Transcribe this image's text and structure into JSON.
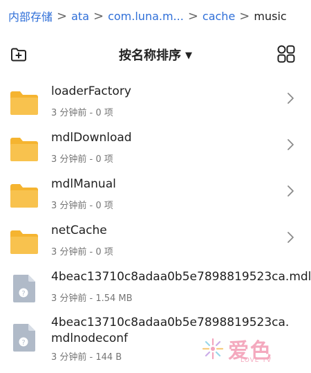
{
  "breadcrumb": {
    "items": [
      "内部存储",
      "ata",
      "com.luna.m...",
      "cache",
      "music"
    ],
    "separator": ">"
  },
  "toolbar": {
    "sort_label": "按名称排序",
    "sort_arrow": "▼"
  },
  "files": [
    {
      "name": "loaderFactory",
      "meta": "3 分钟前 - 0 项",
      "type": "folder"
    },
    {
      "name": "mdlDownload",
      "meta": "3 分钟前 - 0 项",
      "type": "folder"
    },
    {
      "name": "mdlManual",
      "meta": "3 分钟前 - 0 项",
      "type": "folder"
    },
    {
      "name": "netCache",
      "meta": "3 分钟前 - 0 项",
      "type": "folder"
    },
    {
      "name": "4beac13710c8adaa0b5e7898819523ca.mdl",
      "meta": "3 分钟前 - 1.54 MB",
      "type": "file"
    },
    {
      "name": "4beac13710c8adaa0b5e7898819523ca.mdlnodeconf",
      "meta": "3 分钟前 - 144 B",
      "type": "file"
    }
  ],
  "watermark": {
    "text": "爱色",
    "sub": "LOVE TV"
  },
  "colors": {
    "accent": "#2f6fd8",
    "folder": "#f5b430",
    "file_icon": "#b0bac8"
  },
  "icons": {
    "new_folder": "add-folder-icon",
    "view_grid": "grid-view-icon",
    "chevron": "chevron-right-icon",
    "folder": "folder-icon",
    "file": "unknown-file-icon"
  }
}
